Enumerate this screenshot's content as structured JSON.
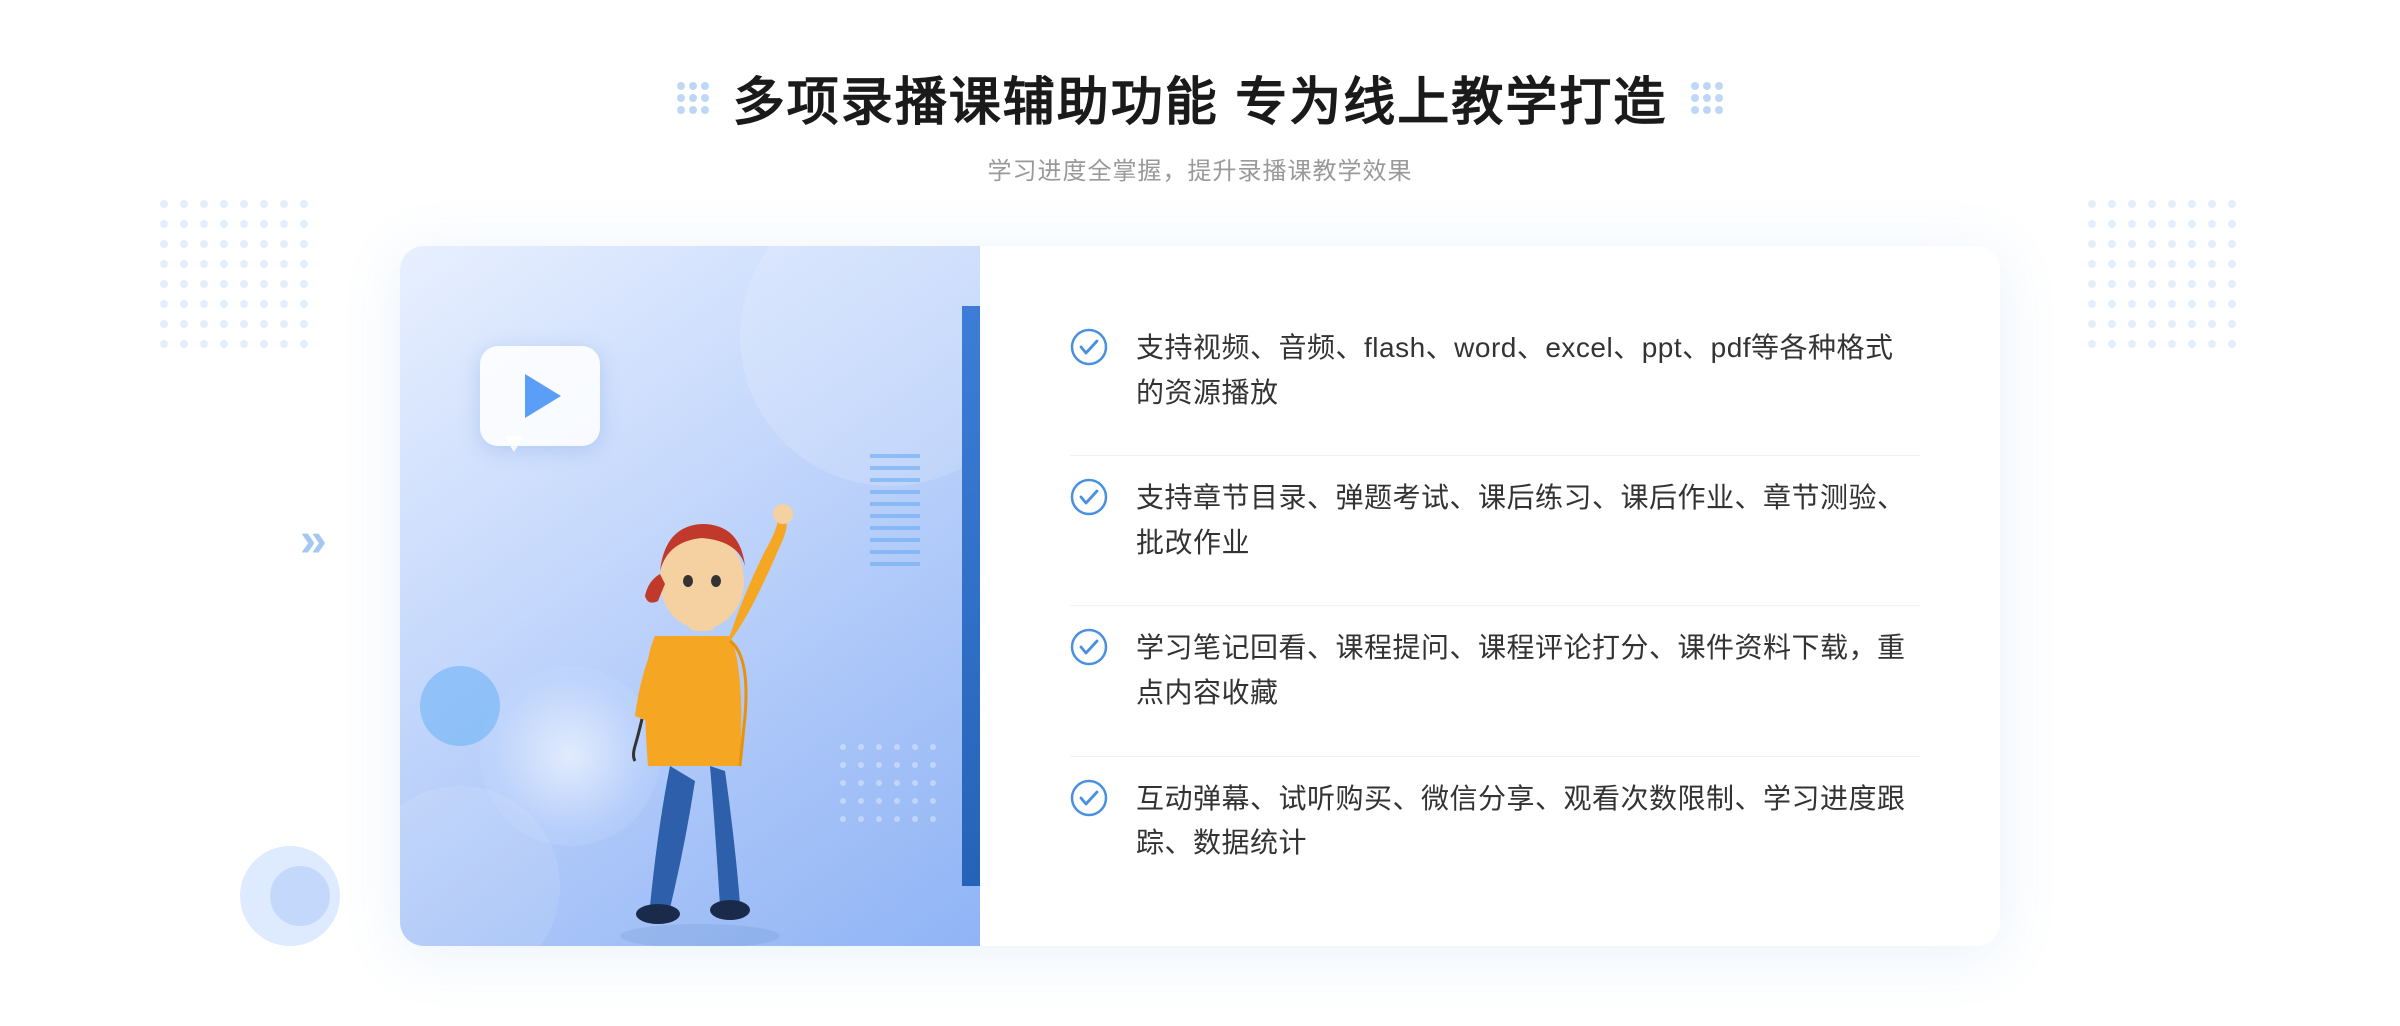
{
  "header": {
    "title": "多项录播课辅助功能 专为线上教学打造",
    "subtitle": "学习进度全掌握，提升录播课教学效果"
  },
  "features": [
    {
      "id": "feature-1",
      "text": "支持视频、音频、flash、word、excel、ppt、pdf等各种格式的资源播放"
    },
    {
      "id": "feature-2",
      "text": "支持章节目录、弹题考试、课后练习、课后作业、章节测验、批改作业"
    },
    {
      "id": "feature-3",
      "text": "学习笔记回看、课程提问、课程评论打分、课件资料下载，重点内容收藏"
    },
    {
      "id": "feature-4",
      "text": "互动弹幕、试听购买、微信分享、观看次数限制、学习进度跟踪、数据统计"
    }
  ],
  "check_icon_symbol": "✓",
  "arrow_symbol": "»",
  "decorator_dots_title_left": "···",
  "decorator_dots_title_right": "···"
}
